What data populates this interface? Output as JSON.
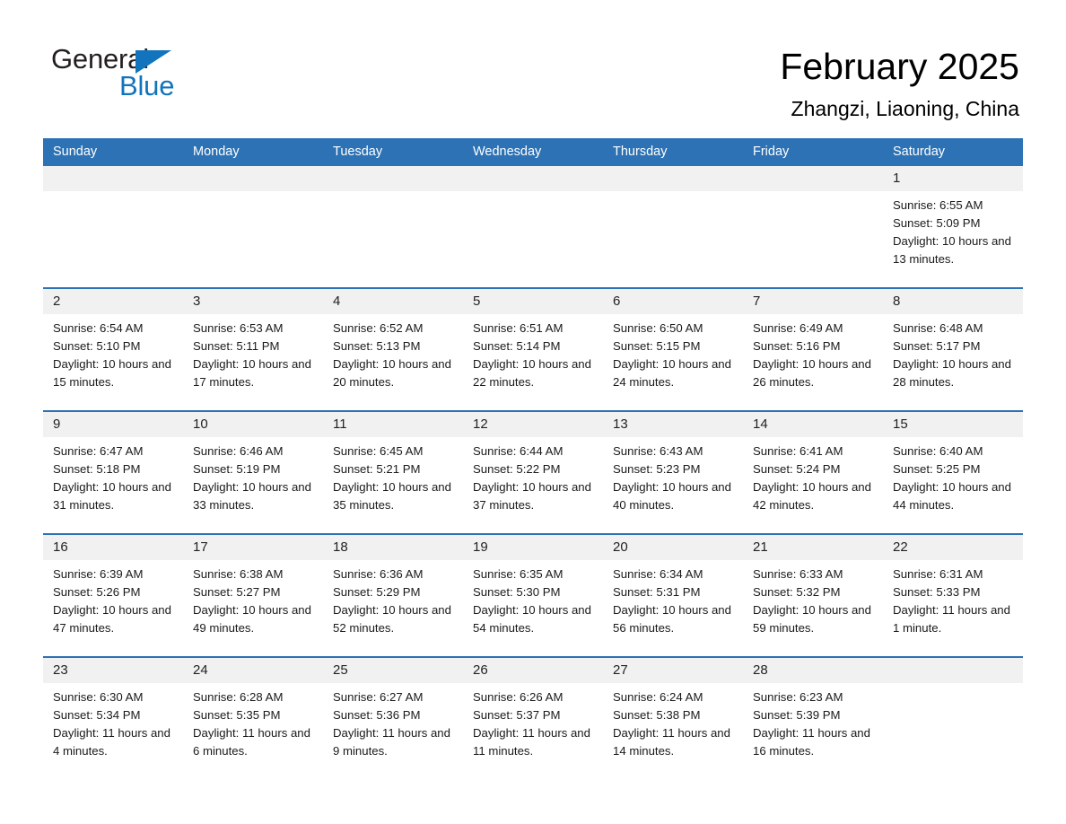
{
  "brand": {
    "name_part1": "General",
    "name_part2": "Blue",
    "accent_color": "#1274bc"
  },
  "header": {
    "title": "February 2025",
    "location": "Zhangzi, Liaoning, China"
  },
  "theme": {
    "header_blue": "#2d72b4",
    "daynum_band": "#f1f1f1"
  },
  "weekdays": [
    "Sunday",
    "Monday",
    "Tuesday",
    "Wednesday",
    "Thursday",
    "Friday",
    "Saturday"
  ],
  "labels": {
    "sunrise_prefix": "Sunrise:",
    "sunset_prefix": "Sunset:",
    "daylight_prefix": "Daylight:"
  },
  "weeks": [
    [
      {
        "day": "",
        "sunrise": "",
        "sunset": "",
        "daylight": ""
      },
      {
        "day": "",
        "sunrise": "",
        "sunset": "",
        "daylight": ""
      },
      {
        "day": "",
        "sunrise": "",
        "sunset": "",
        "daylight": ""
      },
      {
        "day": "",
        "sunrise": "",
        "sunset": "",
        "daylight": ""
      },
      {
        "day": "",
        "sunrise": "",
        "sunset": "",
        "daylight": ""
      },
      {
        "day": "",
        "sunrise": "",
        "sunset": "",
        "daylight": ""
      },
      {
        "day": "1",
        "sunrise": "Sunrise: 6:55 AM",
        "sunset": "Sunset: 5:09 PM",
        "daylight": "Daylight: 10 hours and 13 minutes."
      }
    ],
    [
      {
        "day": "2",
        "sunrise": "Sunrise: 6:54 AM",
        "sunset": "Sunset: 5:10 PM",
        "daylight": "Daylight: 10 hours and 15 minutes."
      },
      {
        "day": "3",
        "sunrise": "Sunrise: 6:53 AM",
        "sunset": "Sunset: 5:11 PM",
        "daylight": "Daylight: 10 hours and 17 minutes."
      },
      {
        "day": "4",
        "sunrise": "Sunrise: 6:52 AM",
        "sunset": "Sunset: 5:13 PM",
        "daylight": "Daylight: 10 hours and 20 minutes."
      },
      {
        "day": "5",
        "sunrise": "Sunrise: 6:51 AM",
        "sunset": "Sunset: 5:14 PM",
        "daylight": "Daylight: 10 hours and 22 minutes."
      },
      {
        "day": "6",
        "sunrise": "Sunrise: 6:50 AM",
        "sunset": "Sunset: 5:15 PM",
        "daylight": "Daylight: 10 hours and 24 minutes."
      },
      {
        "day": "7",
        "sunrise": "Sunrise: 6:49 AM",
        "sunset": "Sunset: 5:16 PM",
        "daylight": "Daylight: 10 hours and 26 minutes."
      },
      {
        "day": "8",
        "sunrise": "Sunrise: 6:48 AM",
        "sunset": "Sunset: 5:17 PM",
        "daylight": "Daylight: 10 hours and 28 minutes."
      }
    ],
    [
      {
        "day": "9",
        "sunrise": "Sunrise: 6:47 AM",
        "sunset": "Sunset: 5:18 PM",
        "daylight": "Daylight: 10 hours and 31 minutes."
      },
      {
        "day": "10",
        "sunrise": "Sunrise: 6:46 AM",
        "sunset": "Sunset: 5:19 PM",
        "daylight": "Daylight: 10 hours and 33 minutes."
      },
      {
        "day": "11",
        "sunrise": "Sunrise: 6:45 AM",
        "sunset": "Sunset: 5:21 PM",
        "daylight": "Daylight: 10 hours and 35 minutes."
      },
      {
        "day": "12",
        "sunrise": "Sunrise: 6:44 AM",
        "sunset": "Sunset: 5:22 PM",
        "daylight": "Daylight: 10 hours and 37 minutes."
      },
      {
        "day": "13",
        "sunrise": "Sunrise: 6:43 AM",
        "sunset": "Sunset: 5:23 PM",
        "daylight": "Daylight: 10 hours and 40 minutes."
      },
      {
        "day": "14",
        "sunrise": "Sunrise: 6:41 AM",
        "sunset": "Sunset: 5:24 PM",
        "daylight": "Daylight: 10 hours and 42 minutes."
      },
      {
        "day": "15",
        "sunrise": "Sunrise: 6:40 AM",
        "sunset": "Sunset: 5:25 PM",
        "daylight": "Daylight: 10 hours and 44 minutes."
      }
    ],
    [
      {
        "day": "16",
        "sunrise": "Sunrise: 6:39 AM",
        "sunset": "Sunset: 5:26 PM",
        "daylight": "Daylight: 10 hours and 47 minutes."
      },
      {
        "day": "17",
        "sunrise": "Sunrise: 6:38 AM",
        "sunset": "Sunset: 5:27 PM",
        "daylight": "Daylight: 10 hours and 49 minutes."
      },
      {
        "day": "18",
        "sunrise": "Sunrise: 6:36 AM",
        "sunset": "Sunset: 5:29 PM",
        "daylight": "Daylight: 10 hours and 52 minutes."
      },
      {
        "day": "19",
        "sunrise": "Sunrise: 6:35 AM",
        "sunset": "Sunset: 5:30 PM",
        "daylight": "Daylight: 10 hours and 54 minutes."
      },
      {
        "day": "20",
        "sunrise": "Sunrise: 6:34 AM",
        "sunset": "Sunset: 5:31 PM",
        "daylight": "Daylight: 10 hours and 56 minutes."
      },
      {
        "day": "21",
        "sunrise": "Sunrise: 6:33 AM",
        "sunset": "Sunset: 5:32 PM",
        "daylight": "Daylight: 10 hours and 59 minutes."
      },
      {
        "day": "22",
        "sunrise": "Sunrise: 6:31 AM",
        "sunset": "Sunset: 5:33 PM",
        "daylight": "Daylight: 11 hours and 1 minute."
      }
    ],
    [
      {
        "day": "23",
        "sunrise": "Sunrise: 6:30 AM",
        "sunset": "Sunset: 5:34 PM",
        "daylight": "Daylight: 11 hours and 4 minutes."
      },
      {
        "day": "24",
        "sunrise": "Sunrise: 6:28 AM",
        "sunset": "Sunset: 5:35 PM",
        "daylight": "Daylight: 11 hours and 6 minutes."
      },
      {
        "day": "25",
        "sunrise": "Sunrise: 6:27 AM",
        "sunset": "Sunset: 5:36 PM",
        "daylight": "Daylight: 11 hours and 9 minutes."
      },
      {
        "day": "26",
        "sunrise": "Sunrise: 6:26 AM",
        "sunset": "Sunset: 5:37 PM",
        "daylight": "Daylight: 11 hours and 11 minutes."
      },
      {
        "day": "27",
        "sunrise": "Sunrise: 6:24 AM",
        "sunset": "Sunset: 5:38 PM",
        "daylight": "Daylight: 11 hours and 14 minutes."
      },
      {
        "day": "28",
        "sunrise": "Sunrise: 6:23 AM",
        "sunset": "Sunset: 5:39 PM",
        "daylight": "Daylight: 11 hours and 16 minutes."
      },
      {
        "day": "",
        "sunrise": "",
        "sunset": "",
        "daylight": ""
      }
    ]
  ]
}
